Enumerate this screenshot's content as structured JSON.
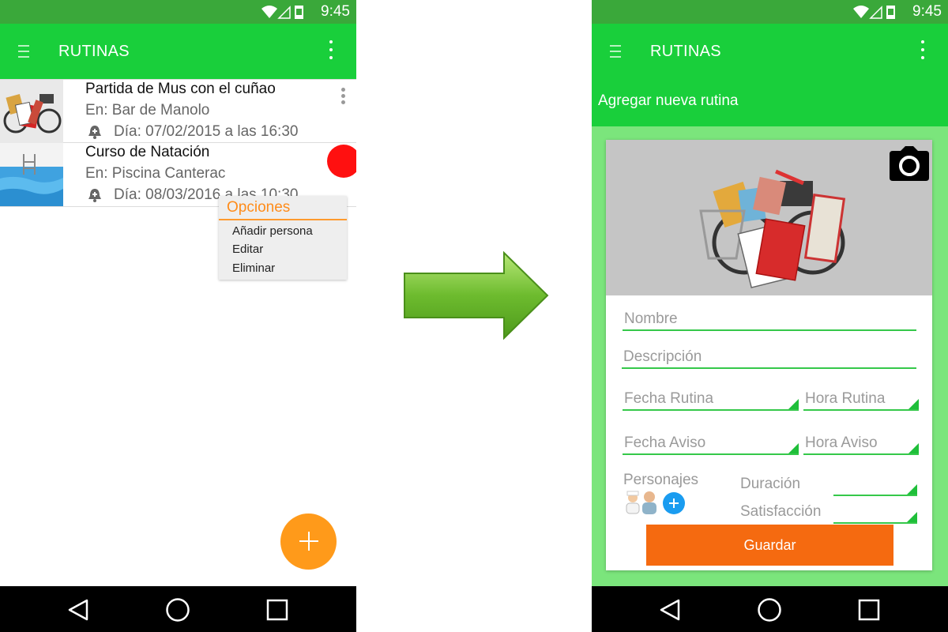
{
  "status_time": "9:45",
  "left": {
    "app_title": "RUTINAS",
    "routines": [
      {
        "title": "Partida de Mus con el cuñao",
        "place": "En: Bar de Manolo",
        "date": "Día: 07/02/2015 a las 16:30"
      },
      {
        "title": "Curso de Natación",
        "place": "En: Piscina Canterac",
        "date": "Día: 08/03/2016 a las 10:30"
      }
    ],
    "popup": {
      "header": "Opciones",
      "items": [
        "Añadir persona",
        "Editar",
        "Eliminar"
      ]
    }
  },
  "right": {
    "app_title": "RUTINAS",
    "subheader": "Agregar nueva rutina",
    "fields": {
      "nombre": "Nombre",
      "descripcion": "Descripción",
      "fecha_rutina": "Fecha Rutina",
      "hora_rutina": "Hora Rutina",
      "fecha_aviso": "Fecha Aviso",
      "hora_aviso": "Hora Aviso",
      "personajes": "Personajes",
      "duracion": "Duración",
      "satisfaccion": "Satisfacción"
    },
    "save_label": "Guardar"
  },
  "colors": {
    "appbar": "#19cf3b",
    "statusbar": "#3aa83a",
    "accent_orange": "#ff9a1a",
    "save_button": "#f56a10",
    "form_bg": "#7be57c"
  }
}
